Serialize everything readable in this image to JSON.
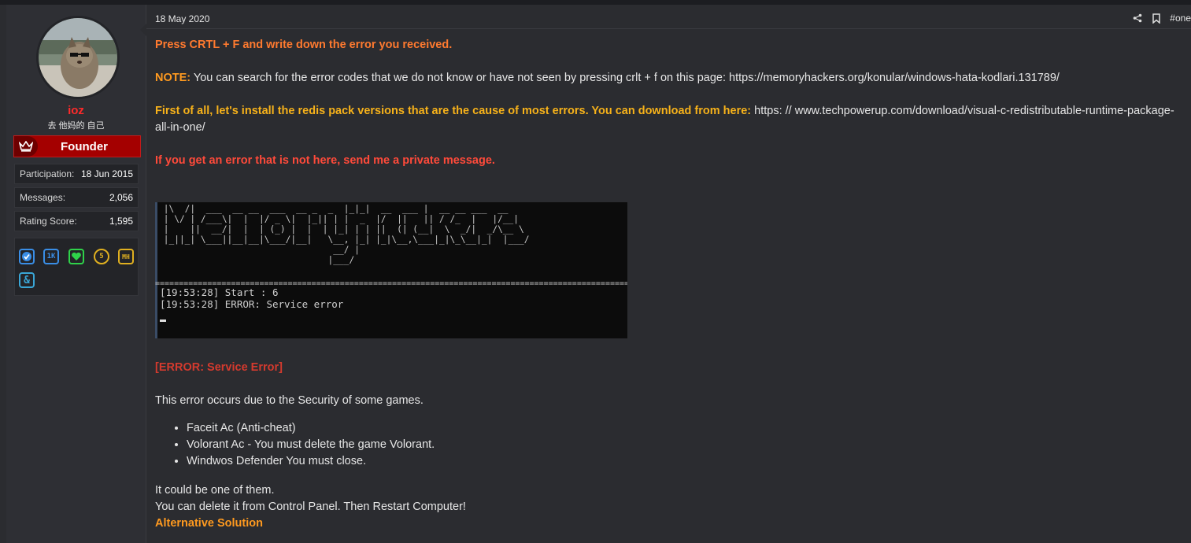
{
  "user": {
    "name": "ioz",
    "title": "去 他妈的 自己",
    "banner": "Founder",
    "stats": [
      {
        "label": "Participation:",
        "value": "18 Jun 2015"
      },
      {
        "label": "Messages:",
        "value": "2,056"
      },
      {
        "label": "Rating Score:",
        "value": "1,595"
      }
    ],
    "trophies": [
      {
        "icon": "verified-check-icon",
        "text": "",
        "color": "#3a8ee6"
      },
      {
        "icon": "1k-badge-icon",
        "text": "1K",
        "color": "#3a8ee6"
      },
      {
        "icon": "heart-icon",
        "text": "",
        "color": "#2fd24a"
      },
      {
        "icon": "five-years-icon",
        "text": "5",
        "color": "#e0b020"
      },
      {
        "icon": "mh-badge-icon",
        "text": "MH",
        "color": "#e0b020"
      },
      {
        "icon": "ampersand-icon",
        "text": "&",
        "color": "#3aa6d6"
      }
    ]
  },
  "post": {
    "date": "18 May 2020",
    "permalink": "#one",
    "line1": "Press CRTL + F and write down the error you received.",
    "note_label": "NOTE:",
    "note_text": " You can search for the error codes that we do not know or have not seen by pressing crlt + f on this page: https://memoryhackers.org/konular/windows-hata-kodlari.131789/",
    "first_bold": "First of all, let's install the redis pack versions that are the cause of most errors. You can download from here:",
    "first_link": " https: // www.techpowerup.com/download/visual-c-redistributable-runtime-package-all-in-one/",
    "private_msg": "If you get an error that is not here, send me a private message.",
    "console": {
      "line1": "[19:53:28] Start : 6",
      "line2": "[19:53:28] ERROR: Service error"
    },
    "error_heading": "[ERROR: Service Error]",
    "error_desc": "This error occurs due to the Security of some games.",
    "bullets": [
      "Faceit Ac (Anti-cheat)",
      "Volorant Ac - You must delete the game Volorant.",
      "Windwos Defender You must close."
    ],
    "outro1": "It could be one of them.",
    "outro2": "You can delete it from Control Panel. Then Restart Computer!",
    "alt_solution": "Alternative Solution"
  },
  "colors": {
    "accent_orange": "#ff7a2f",
    "accent_yellow": "#f7b21a",
    "accent_red": "#ff4a3a",
    "founder_red": "#a40000"
  }
}
